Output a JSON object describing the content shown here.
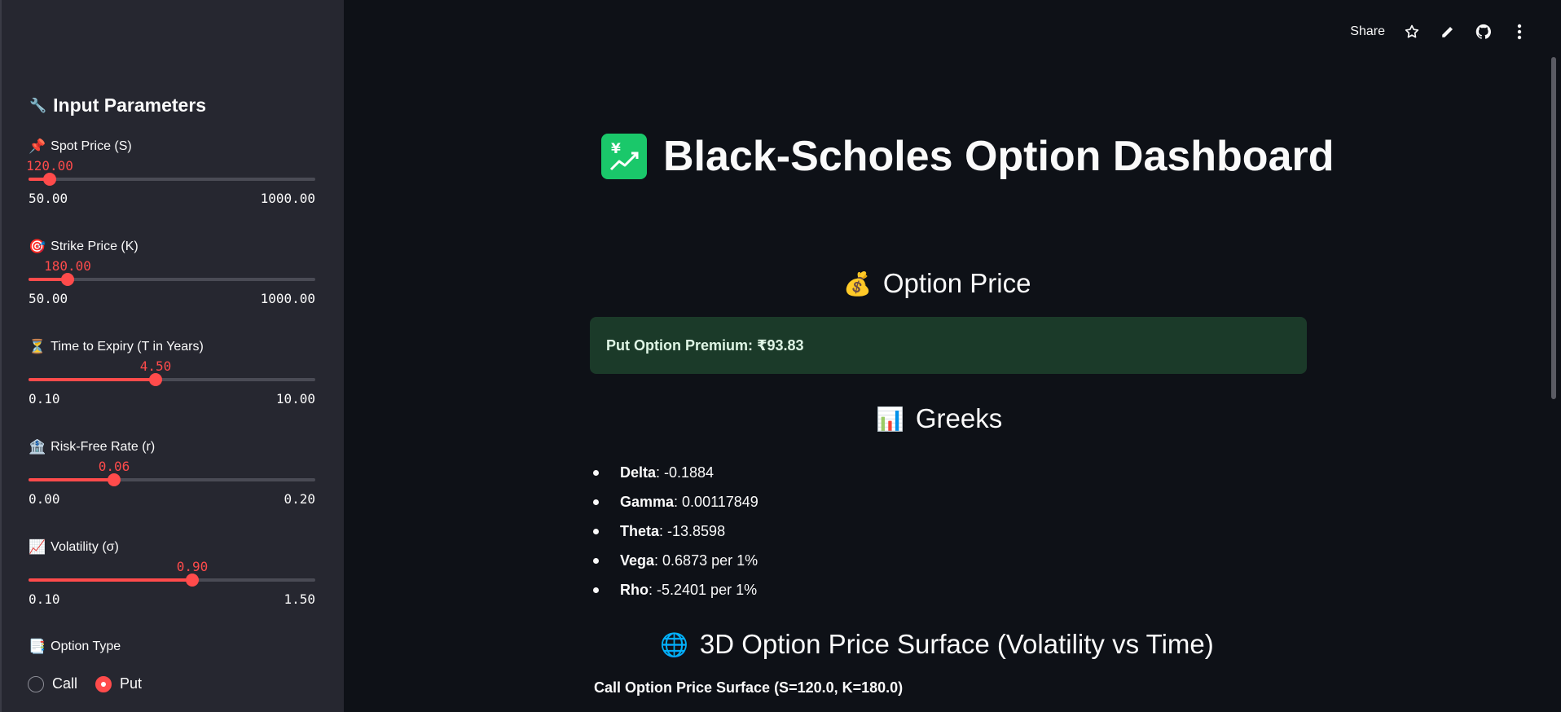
{
  "toolbar": {
    "share_label": "Share",
    "icons": [
      "star-icon",
      "pencil-icon",
      "github-icon",
      "more-vert-icon"
    ]
  },
  "sidebar": {
    "title": "Input Parameters",
    "title_emoji": "🔧",
    "params": [
      {
        "emoji": "📌",
        "label": "Spot Price (S)",
        "value": "120.00",
        "min": "50.00",
        "max": "1000.00",
        "fraction": 0.074
      },
      {
        "emoji": "🎯",
        "label": "Strike Price (K)",
        "value": "180.00",
        "min": "50.00",
        "max": "1000.00",
        "fraction": 0.137
      },
      {
        "emoji": "⏳",
        "label": "Time to Expiry (T in Years)",
        "value": "4.50",
        "min": "0.10",
        "max": "10.00",
        "fraction": 0.444
      },
      {
        "emoji": "🏦",
        "label": "Risk-Free Rate (r)",
        "value": "0.06",
        "min": "0.00",
        "max": "0.20",
        "fraction": 0.3
      },
      {
        "emoji": "📈",
        "label": "Volatility (σ)",
        "value": "0.90",
        "min": "0.10",
        "max": "1.50",
        "fraction": 0.571
      }
    ],
    "option_type": {
      "emoji": "📑",
      "label": "Option Type",
      "options": [
        "Call",
        "Put"
      ],
      "selected": "Put"
    }
  },
  "main": {
    "title": "Black-Scholes Option Dashboard",
    "price_section": {
      "emoji": "💰",
      "heading": "Option Price"
    },
    "premium_text": "Put Option Premium: ₹93.83",
    "greeks_section": {
      "emoji": "📊",
      "heading": "Greeks"
    },
    "greeks": [
      {
        "name": "Delta",
        "value": ": -0.1884"
      },
      {
        "name": "Gamma",
        "value": ": 0.00117849"
      },
      {
        "name": "Theta",
        "value": ": -13.8598"
      },
      {
        "name": "Vega",
        "value": ": 0.6873 per 1%"
      },
      {
        "name": "Rho",
        "value": ": -5.2401 per 1%"
      }
    ],
    "surface_section": {
      "emoji": "🌐",
      "heading": "3D Option Price Surface (Volatility vs Time)"
    },
    "surface_caption": "Call Option Price Surface (S=120.0, K=180.0)"
  },
  "colors": {
    "accent": "#ff4b4b",
    "background": "#0e1117",
    "sidebar": "#262730",
    "success_bg": "#1b3a29"
  }
}
